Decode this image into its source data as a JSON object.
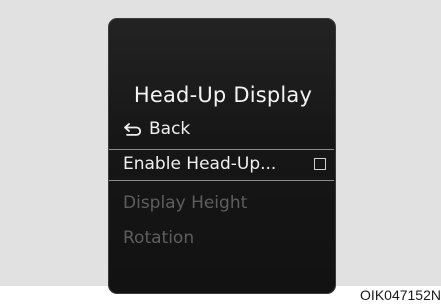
{
  "screen": {
    "title": "Head-Up Display",
    "back_label": "Back",
    "menu": {
      "enable_label": "Enable Head-Up...",
      "enable_checked": false,
      "height_label": "Display Height",
      "rotation_label": "Rotation"
    }
  },
  "figure_code": "OIK047152N",
  "icons": {
    "back": "back-arrow-icon",
    "checkbox": "checkbox-icon"
  },
  "colors": {
    "screen_bg": "#161616",
    "text": "#f0f0f0",
    "disabled_text": "#5e5e5e",
    "frame_bg": "#e1e1e1"
  }
}
